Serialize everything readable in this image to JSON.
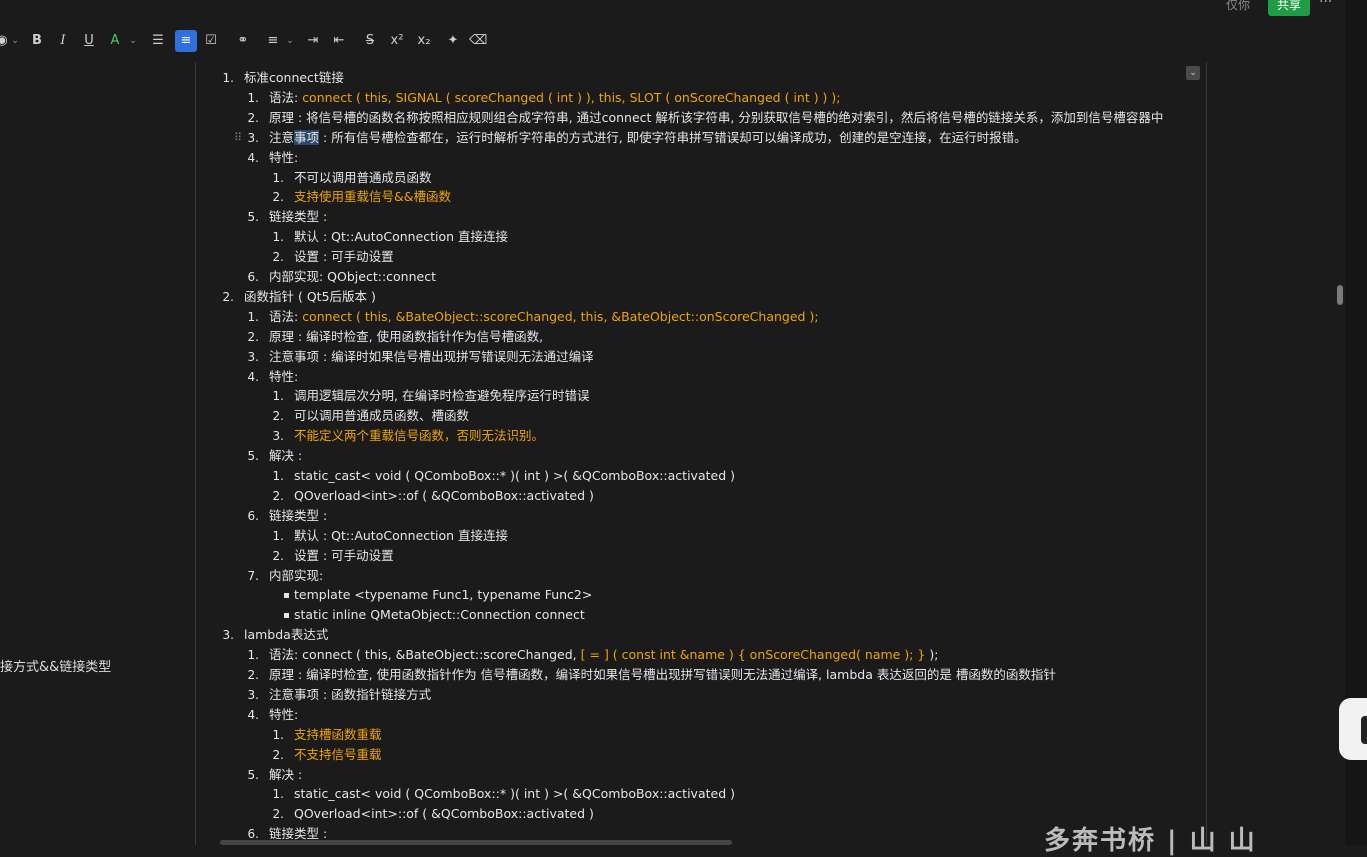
{
  "toolbar": {
    "icons": [
      "color-circle-icon",
      "bold-icon",
      "italic-icon",
      "underline-icon",
      "font-color-icon",
      "bullet-list-icon",
      "numbered-list-icon",
      "checklist-icon",
      "link-icon",
      "align-icon",
      "indent-icon",
      "outdent-icon",
      "strikethrough-icon",
      "superscript-icon",
      "subscript-icon",
      "magic-wand-icon",
      "clear-format-icon"
    ],
    "glyphs": {
      "bold": "B",
      "italic": "I",
      "underline": "U",
      "font_color": "A",
      "superscript": "x²",
      "subscript": "x₂"
    },
    "active_color": "#2f6fde"
  },
  "top_right": {
    "user_text": "仅你",
    "share_label": "共享",
    "more_label": "···",
    "share_color": "#1f9d46"
  },
  "left_panel": {
    "item_label": "接方式&&链接类型"
  },
  "colors": {
    "accent_text": "#f0a500",
    "background": "#1b1b1b",
    "text": "#e6e6e6"
  },
  "document": {
    "lines": [
      {
        "num": "1.",
        "text": "标准connect链接",
        "level": 0
      },
      {
        "num": "1.",
        "label": "语法: ",
        "text": "connect ( this, SIGNAL ( scoreChanged ( int ) ), this, SLOT ( onScoreChanged ( int ) ) );",
        "level": 1,
        "orange": true
      },
      {
        "num": "2.",
        "text": "原理 : 将信号槽的函数名称按照相应规则组合成字符串, 通过connect 解析该字符串, 分别获取信号槽的绝对索引，然后将信号槽的链接关系，添加到信号槽容器中",
        "level": 1
      },
      {
        "num": "3.",
        "pre": "注意",
        "hl": "事项",
        "text": " : 所有信号槽检查都在，运行时解析字符串的方式进行, 即使字符串拼写错误却可以编译成功，创建的是空连接，在运行时报错。",
        "level": 1
      },
      {
        "num": "4.",
        "text": "特性:",
        "level": 1
      },
      {
        "num": "1.",
        "text": "不可以调用普通成员函数",
        "level": 2
      },
      {
        "num": "2.",
        "text": "支持使用重载信号&&槽函数",
        "level": 2,
        "orange": true
      },
      {
        "num": "5.",
        "text": "链接类型 :",
        "level": 1
      },
      {
        "num": "1.",
        "text": "默认 : Qt::AutoConnection 直接连接",
        "level": 2
      },
      {
        "num": "2.",
        "text": "设置 : 可手动设置",
        "level": 2
      },
      {
        "num": "6.",
        "text": "内部实现:   QObject::connect",
        "level": 1
      },
      {
        "num": "2.",
        "text": "函数指针 ( Qt5后版本 )",
        "level": 0
      },
      {
        "num": "1.",
        "label": "语法: ",
        "text": "connect ( this, &BateObject::scoreChanged, this, &BateObject::onScoreChanged );",
        "level": 1,
        "orange": true
      },
      {
        "num": "2.",
        "text": "原理 : 编译时检查, 使用函数指针作为信号槽函数,",
        "level": 1
      },
      {
        "num": "3.",
        "text": "注意事项 : 编译时如果信号槽出现拼写错误则无法通过编译",
        "level": 1
      },
      {
        "num": "4.",
        "text": "特性:",
        "level": 1
      },
      {
        "num": "1.",
        "text": "调用逻辑层次分明, 在编译时检查避免程序运行时错误",
        "level": 2
      },
      {
        "num": "2.",
        "text": "可以调用普通成员函数、槽函数",
        "level": 2
      },
      {
        "num": "3.",
        "text": "不能定义两个重载信号函数，否则无法识别。",
        "level": 2,
        "orange": true
      },
      {
        "num": "5.",
        "text": "解决 :",
        "level": 1
      },
      {
        "num": "1.",
        "text": "static_cast< void ( QComboBox::* )( int ) >( &QComboBox::activated )",
        "level": 2
      },
      {
        "num": "2.",
        "text": "QOverload<int>::of ( &QComboBox::activated )",
        "level": 2
      },
      {
        "num": "6.",
        "text": "链接类型 :",
        "level": 1
      },
      {
        "num": "1.",
        "text": "默认 : Qt::AutoConnection 直接连接",
        "level": 2
      },
      {
        "num": "2.",
        "text": "设置 : 可手动设置",
        "level": 2
      },
      {
        "num": "7.",
        "text": "内部实现:",
        "level": 1
      },
      {
        "num": "",
        "text": "template <typename Func1, typename Func2>",
        "level": 2,
        "bullet": true
      },
      {
        "num": "",
        "text": "static inline QMetaObject::Connection connect",
        "level": 2,
        "bullet": true
      },
      {
        "num": "3.",
        "text": "lambda表达式",
        "level": 0
      },
      {
        "num": "1.",
        "label": "语法: connect ( this, &BateObject::scoreChanged, ",
        "text": "[ = ] ( const int &name ) { onScoreChanged( name ); } ",
        "tail": ");",
        "level": 1,
        "orange": true
      },
      {
        "num": "2.",
        "text": "原理 : 编译时检查, 使用函数指针作为 信号槽函数，编译时如果信号槽出现拼写错误则无法通过编译, lambda 表达返回的是 槽函数的函数指针",
        "level": 1
      },
      {
        "num": "3.",
        "text": "注意事项 :  函数指针链接方式",
        "level": 1
      },
      {
        "num": "4.",
        "text": "特性:",
        "level": 1
      },
      {
        "num": "1.",
        "text": "支持槽函数重载",
        "level": 2,
        "orange": true
      },
      {
        "num": "2.",
        "text": "不支持信号重载",
        "level": 2,
        "orange": true
      },
      {
        "num": "5.",
        "text": "解决 :",
        "level": 1
      },
      {
        "num": "1.",
        "text": "static_cast< void ( QComboBox::* )( int ) >( &QComboBox::activated )",
        "level": 2
      },
      {
        "num": "2.",
        "text": "QOverload<int>::of ( &QComboBox::activated )",
        "level": 2
      },
      {
        "num": "6.",
        "text": "链接类型 :",
        "level": 1
      }
    ]
  },
  "watermark": "多奔书桥 | 山 山"
}
